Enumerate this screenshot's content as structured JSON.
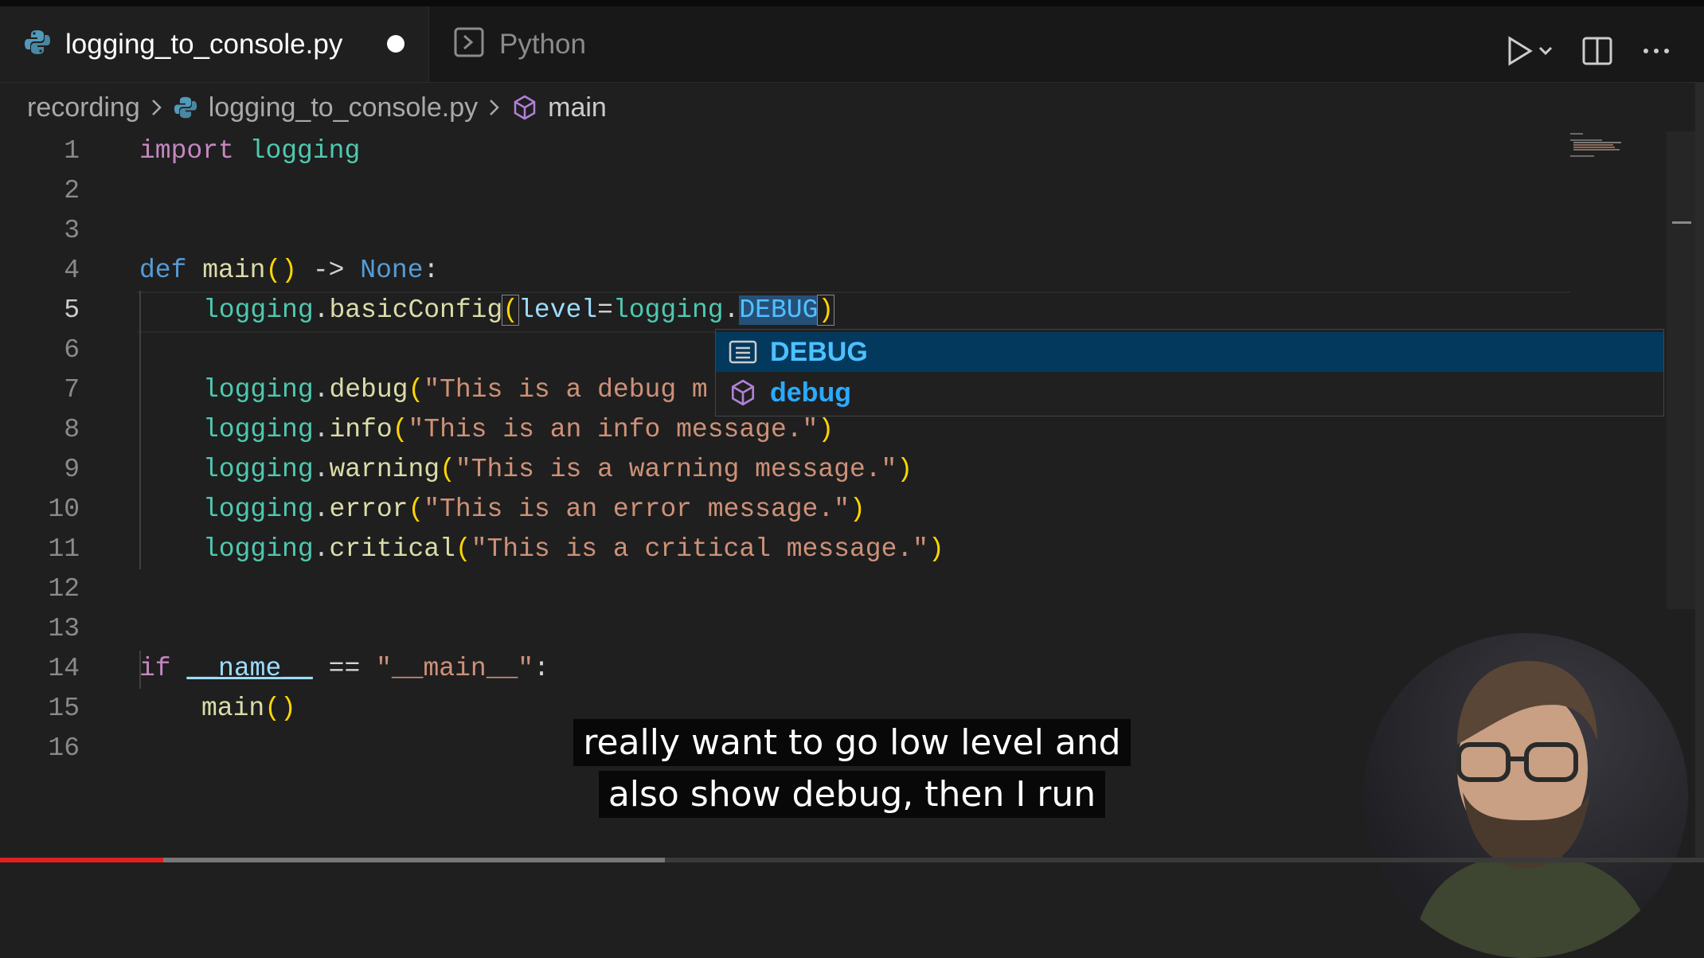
{
  "tabs": [
    {
      "label": "logging_to_console.py",
      "icon": "python-icon",
      "active": true,
      "dirty": true
    },
    {
      "label": "Python",
      "icon": "terminal-icon",
      "active": false
    }
  ],
  "breadcrumb": {
    "folder": "recording",
    "file": "logging_to_console.py",
    "symbol": "main"
  },
  "code": {
    "line_numbers": [
      "1",
      "2",
      "3",
      "4",
      "5",
      "6",
      "7",
      "8",
      "9",
      "10",
      "11",
      "12",
      "13",
      "14",
      "15",
      "16"
    ],
    "l1": {
      "kw": "import",
      "mod": "logging"
    },
    "l4": {
      "kw": "def",
      "fn": "main",
      "parens": "()",
      "arrow": " -> ",
      "type": "None",
      "colon": ":"
    },
    "l5": {
      "obj": "logging",
      "dot": ".",
      "fn": "basicConfig",
      "open": "(",
      "param": "level",
      "eq": "=",
      "obj2": "logging",
      "dot2": ".",
      "const": "DEBUG",
      "close": ")"
    },
    "l7": {
      "obj": "logging",
      "fn": "debug",
      "str": "\"This is a debug m"
    },
    "l8": {
      "obj": "logging",
      "fn": "info",
      "str": "\"This is an info message.\""
    },
    "l9": {
      "obj": "logging",
      "fn": "warning",
      "str": "\"This is a warning message.\""
    },
    "l10": {
      "obj": "logging",
      "fn": "error",
      "str": "\"This is an error message.\""
    },
    "l11": {
      "obj": "logging",
      "fn": "critical",
      "str": "\"This is a critical message.\""
    },
    "l14": {
      "kw": "if",
      "var": "__name__",
      "op": " == ",
      "str": "\"__main__\"",
      "colon": ":"
    },
    "l15": {
      "fn": "main",
      "parens": "()"
    }
  },
  "suggestions": [
    {
      "label": "DEBUG",
      "icon": "constant-icon",
      "selected": true
    },
    {
      "label": "debug",
      "icon": "method-cube-icon",
      "selected": false
    }
  ],
  "caption": {
    "line1": "really want to go low level and",
    "line2": "also show debug, then I run"
  },
  "colors": {
    "accent_selection": "#04395e",
    "keyword": "#c586c0",
    "string": "#ce9178",
    "function": "#dcdcaa",
    "module": "#4ec9b0"
  }
}
